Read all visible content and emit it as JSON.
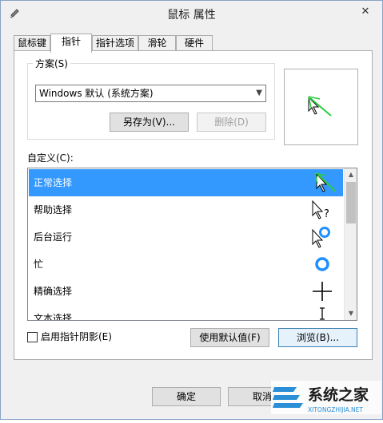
{
  "window": {
    "title": "鼠标 属性",
    "close": "✕"
  },
  "tabs": [
    {
      "label": "鼠标键"
    },
    {
      "label": "指针",
      "active": true
    },
    {
      "label": "指针选项"
    },
    {
      "label": "滑轮"
    },
    {
      "label": "硬件"
    }
  ],
  "scheme": {
    "group_label": "方案(S)",
    "selected": "Windows 默认 (系统方案)",
    "save_as": "另存为(V)...",
    "delete": "删除(D)"
  },
  "customize": {
    "label": "自定义(C):",
    "items": [
      {
        "label": "正常选择",
        "selected": true,
        "icon": "arrow-cursor-icon"
      },
      {
        "label": "帮助选择",
        "icon": "help-cursor-icon"
      },
      {
        "label": "后台运行",
        "icon": "working-in-background-cursor-icon"
      },
      {
        "label": "忙",
        "icon": "busy-cursor-icon"
      },
      {
        "label": "精确选择",
        "icon": "precision-cursor-icon"
      },
      {
        "label": "文本选择",
        "icon": "text-cursor-icon"
      }
    ]
  },
  "shadow_checkbox": {
    "label": "启用指针阴影(E)",
    "checked": false
  },
  "buttons": {
    "use_default": "使用默认值(F)",
    "browse": "浏览(B)...",
    "ok": "确定",
    "cancel": "取消"
  },
  "watermark": {
    "text": "系统之家",
    "sub": "XITONGZHIJIA.NET"
  },
  "colors": {
    "selection": "#3399ff",
    "annotation": "#2ecc40"
  }
}
